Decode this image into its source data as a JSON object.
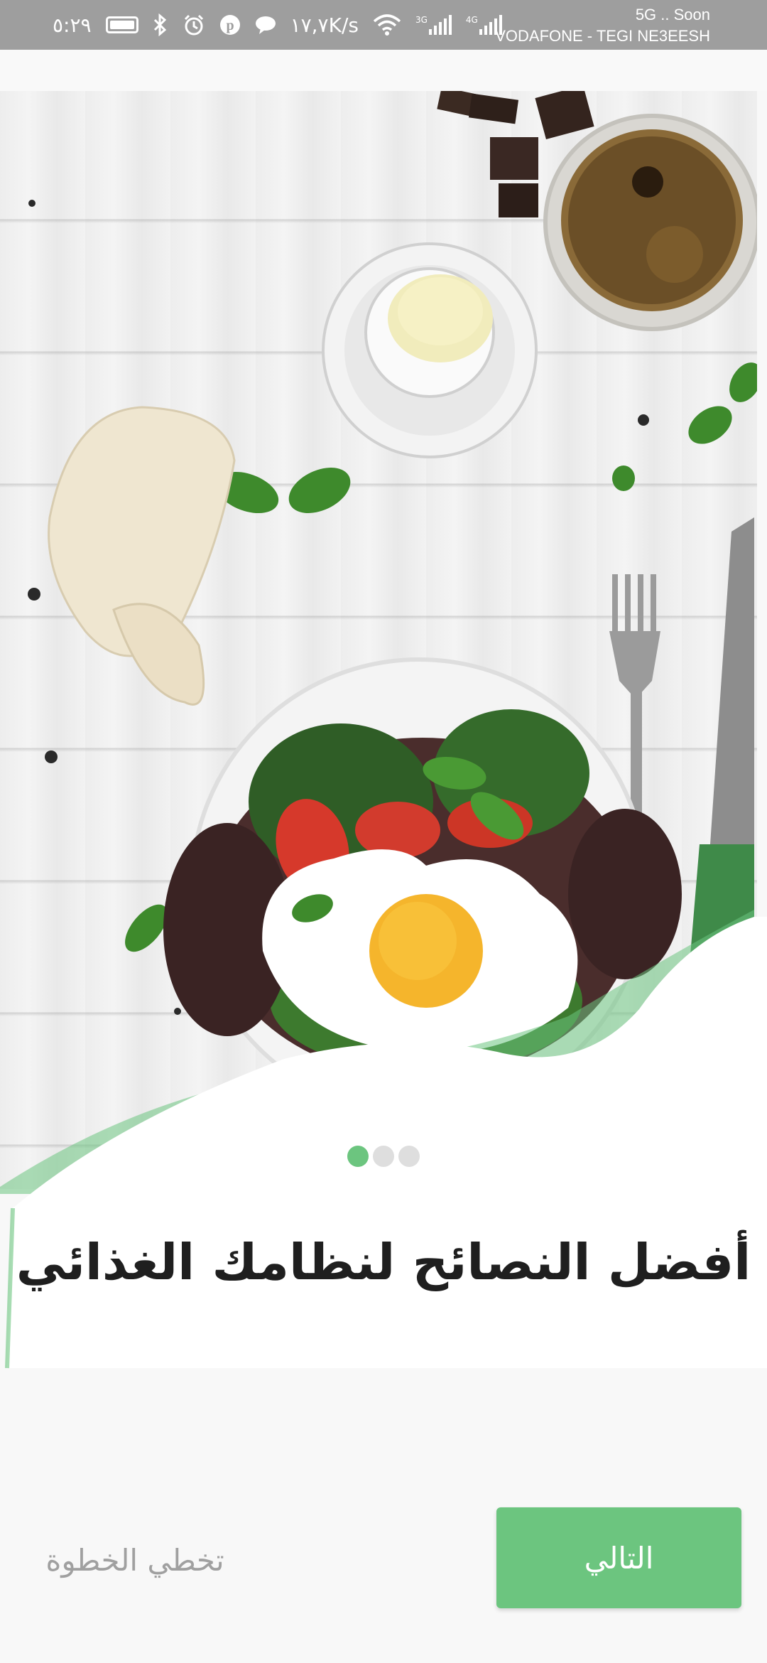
{
  "status_bar": {
    "time": "٥:٢٩",
    "speed": "١٧,٧K/s",
    "net_3g": "3G",
    "net_4g": "4G",
    "line1": "5G .. Soon",
    "line2": "VODAFONE - TEGI NE3EESH",
    "icons": [
      "battery-icon",
      "bluetooth-icon",
      "alarm-icon",
      "pinterest-icon",
      "chat-icon",
      "wifi-icon",
      "signal-icon"
    ]
  },
  "onboarding": {
    "title": "أفضل النصائح لنظامك الغذائي",
    "page_count": 3,
    "active_page": 1
  },
  "actions": {
    "next_label": "التالي",
    "skip_label": "تخطي الخطوة"
  },
  "colors": {
    "accent": "#6cc57f",
    "statusbar": "#9e9e9e",
    "dot_inactive": "#dedede"
  }
}
